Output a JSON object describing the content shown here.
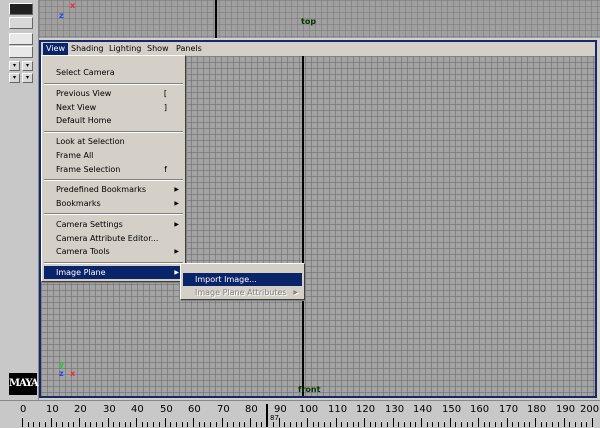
{
  "menubar": [
    "View",
    "Shading",
    "Lighting",
    "Show",
    "Panels"
  ],
  "view_menu": [
    {
      "label": "Select Camera"
    },
    {
      "sep": true
    },
    {
      "label": "Previous View",
      "shortcut": "["
    },
    {
      "label": "Next View",
      "shortcut": "]"
    },
    {
      "label": "Default Home"
    },
    {
      "sep": true
    },
    {
      "label": "Look at Selection"
    },
    {
      "label": "Frame All"
    },
    {
      "label": "Frame Selection",
      "shortcut": "f"
    },
    {
      "sep": true
    },
    {
      "label": "Predefined Bookmarks",
      "submenu": true
    },
    {
      "label": "Bookmarks",
      "submenu": true
    },
    {
      "sep": true
    },
    {
      "label": "Camera Settings",
      "submenu": true
    },
    {
      "label": "Camera Attribute Editor..."
    },
    {
      "label": "Camera Tools",
      "submenu": true
    },
    {
      "sep": true
    },
    {
      "label": "Image Plane",
      "submenu": true,
      "highlighted": true
    }
  ],
  "image_plane_submenu": [
    {
      "label": "Import Image...",
      "highlighted": true
    },
    {
      "label": "Image Plane Attributes",
      "submenu": true,
      "disabled": true
    }
  ],
  "panels": {
    "top_label": "top",
    "front_label": "front"
  },
  "axis_labels": {
    "z": "z",
    "x": "x",
    "y": "y"
  },
  "logo_text": "MAYA",
  "time_ruler": {
    "ticks": [
      0,
      10,
      20,
      30,
      40,
      50,
      60,
      70,
      80,
      90,
      100,
      110,
      120,
      130,
      140,
      150,
      160,
      170,
      180,
      190,
      200
    ],
    "current_frame": "87"
  },
  "colors": {
    "accent": "#0a246a",
    "panel_border": "#14286e",
    "viewport_bg": "#a4a4a4"
  }
}
